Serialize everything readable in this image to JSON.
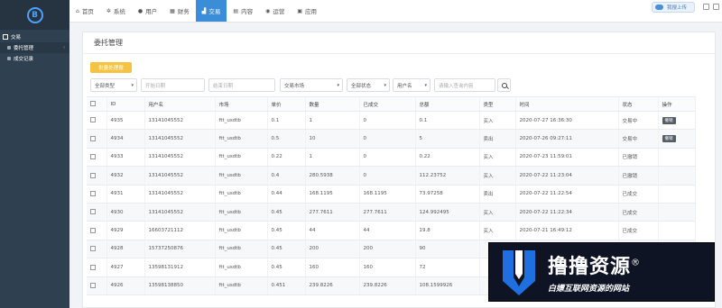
{
  "colors": {
    "sidebar_bg": "#2f4050",
    "accent": "#3c8dd7",
    "batch_button": "#f5c242"
  },
  "sidebar": {
    "group_label": "交易",
    "items": [
      {
        "label": "委托管理",
        "icon": "list-icon",
        "active": true
      },
      {
        "label": "成交记录",
        "icon": "list-icon",
        "active": false
      }
    ]
  },
  "topnav": {
    "tabs": [
      {
        "label": "首页",
        "icon": "home-icon",
        "glyph": "⌂"
      },
      {
        "label": "系统",
        "icon": "gear-icon",
        "glyph": "✲"
      },
      {
        "label": "用户",
        "icon": "user-icon",
        "glyph": "●"
      },
      {
        "label": "财务",
        "icon": "finance-icon",
        "glyph": "▦"
      },
      {
        "label": "交易",
        "icon": "chart-icon",
        "glyph": "▟",
        "active": true
      },
      {
        "label": "内容",
        "icon": "content-icon",
        "glyph": "▤"
      },
      {
        "label": "运营",
        "icon": "operations-icon",
        "glyph": "◉"
      },
      {
        "label": "应用",
        "icon": "apps-icon",
        "glyph": "▣"
      }
    ],
    "cloud_button": "我搜上传"
  },
  "page": {
    "title": "委托管理",
    "batch_button": "批量处理撤",
    "filters": {
      "type": "全部类型",
      "start_date": "开始日期",
      "end_date": "结束日期",
      "market": "交易市场",
      "status": "全部状态",
      "field": "用户名",
      "keyword": "请输入查询内容"
    }
  },
  "table": {
    "headers": [
      "ID",
      "用户名",
      "市场",
      "单价",
      "数量",
      "已成交",
      "总额",
      "类型",
      "时间",
      "状态",
      "操作"
    ],
    "rows": [
      {
        "id": "4935",
        "user": "13141045552",
        "market": "ftt_usdtb",
        "price": "0.1",
        "qty": "1",
        "filled": "0",
        "total": "0.1",
        "type": "买入",
        "time": "2020-07-27 16:36:30",
        "status": "交易中",
        "action": "撤销"
      },
      {
        "id": "4934",
        "user": "13141045552",
        "market": "ftt_usdtb",
        "price": "0.5",
        "qty": "10",
        "filled": "0",
        "total": "5",
        "type": "卖出",
        "time": "2020-07-26 09:27:11",
        "status": "交易中",
        "action": "撤销"
      },
      {
        "id": "4933",
        "user": "13141045552",
        "market": "ftt_usdtb",
        "price": "0.22",
        "qty": "1",
        "filled": "0",
        "total": "0.22",
        "type": "买入",
        "time": "2020-07-23 11:59:01",
        "status": "已撤销",
        "action": ""
      },
      {
        "id": "4932",
        "user": "13141045552",
        "market": "ftt_usdtb",
        "price": "0.4",
        "qty": "280.5938",
        "filled": "0",
        "total": "112.23752",
        "type": "买入",
        "time": "2020-07-22 11:23:04",
        "status": "已撤销",
        "action": ""
      },
      {
        "id": "4931",
        "user": "13141045552",
        "market": "ftt_usdtb",
        "price": "0.44",
        "qty": "168.1195",
        "filled": "168.1195",
        "total": "73.97258",
        "type": "卖出",
        "time": "2020-07-22 11:22:54",
        "status": "已成交",
        "action": ""
      },
      {
        "id": "4930",
        "user": "13141045552",
        "market": "ftt_usdtb",
        "price": "0.45",
        "qty": "277.7611",
        "filled": "277.7611",
        "total": "124.992495",
        "type": "买入",
        "time": "2020-07-22 11:22:34",
        "status": "已成交",
        "action": ""
      },
      {
        "id": "4929",
        "user": "16603721112",
        "market": "ftt_usdtb",
        "price": "0.45",
        "qty": "44",
        "filled": "44",
        "total": "19.8",
        "type": "买入",
        "time": "2020-07-21 16:49:12",
        "status": "已成交",
        "action": ""
      },
      {
        "id": "4928",
        "user": "15737250876",
        "market": "ftt_usdtb",
        "price": "0.45",
        "qty": "200",
        "filled": "200",
        "total": "90",
        "type": "",
        "time": "",
        "status": "",
        "action": ""
      },
      {
        "id": "4927",
        "user": "13598131912",
        "market": "ftt_usdtb",
        "price": "0.45",
        "qty": "160",
        "filled": "160",
        "total": "72",
        "type": "",
        "time": "",
        "status": "",
        "action": ""
      },
      {
        "id": "4926",
        "user": "13598138850",
        "market": "ftt_usdtb",
        "price": "0.451",
        "qty": "239.8226",
        "filled": "239.8226",
        "total": "108.1599926",
        "type": "",
        "time": "",
        "status": "",
        "action": ""
      }
    ]
  },
  "watermark": {
    "main": "撸撸资源",
    "reg": "®",
    "sub": "白嫖互联网资源的网站"
  }
}
